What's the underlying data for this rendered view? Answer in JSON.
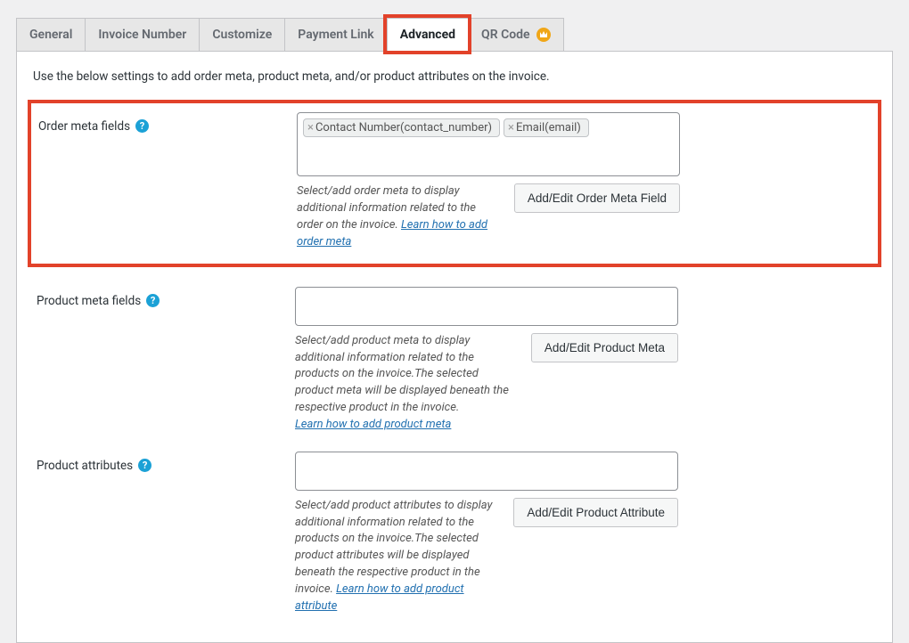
{
  "tabs": {
    "general": "General",
    "invoice_number": "Invoice Number",
    "customize": "Customize",
    "payment_link": "Payment Link",
    "advanced": "Advanced",
    "qr_code": "QR Code"
  },
  "intro": "Use the below settings to add order meta, product meta, and/or product attributes on the invoice.",
  "order_meta": {
    "label": "Order meta fields",
    "tags": [
      "Contact Number(contact_number)",
      "Email(email)"
    ],
    "hint_pre": "Select/add order meta to display additional information related to the order on the invoice. ",
    "hint_link": "Learn how to add order meta",
    "button": "Add/Edit Order Meta Field"
  },
  "product_meta": {
    "label": "Product meta fields",
    "hint_pre": "Select/add product meta to display additional information related to the products on the invoice.The selected product meta will be displayed beneath the respective product in the invoice. ",
    "hint_link": "Learn how to add product meta",
    "button": "Add/Edit Product Meta"
  },
  "product_attr": {
    "label": "Product attributes",
    "hint_pre": "Select/add product attributes to display additional information related to the products on the invoice.The selected product attributes will be displayed beneath the respective product in the invoice. ",
    "hint_link": "Learn how to add product attribute",
    "button": "Add/Edit Product Attribute"
  }
}
